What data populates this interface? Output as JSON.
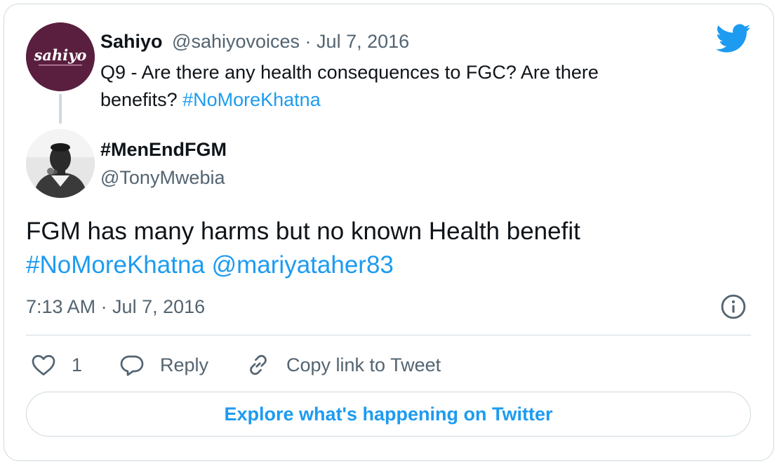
{
  "parent_tweet": {
    "avatar_text": "sahiyo",
    "name": "Sahiyo",
    "handle": "@sahiyovoices",
    "separator": " · ",
    "date": "Jul 7, 2016",
    "text_line1": "Q9 - Are there any health consequences to FGC? Are there",
    "text_line2_prefix": "benefits? ",
    "hashtag": "#NoMoreKhatna"
  },
  "tweet": {
    "author_name": "#MenEndFGM",
    "author_handle": "@TonyMwebia",
    "text": "FGM has many harms but no known Health benefit",
    "hashtag": "#NoMoreKhatna",
    "mention": "@mariyataher83",
    "timestamp": "7:13 AM · Jul 7, 2016"
  },
  "actions": {
    "like_count": "1",
    "reply_label": "Reply",
    "copy_label": "Copy link to Tweet"
  },
  "explore_label": "Explore what's happening on Twitter",
  "colors": {
    "accent": "#1d9bf0",
    "text": "#0f1419",
    "muted": "#536471",
    "border": "#cfd9de",
    "brand_avatar": "#5a1f3f"
  },
  "icons": [
    "twitter-bird-icon",
    "info-icon",
    "heart-icon",
    "reply-bubble-icon",
    "link-icon"
  ]
}
